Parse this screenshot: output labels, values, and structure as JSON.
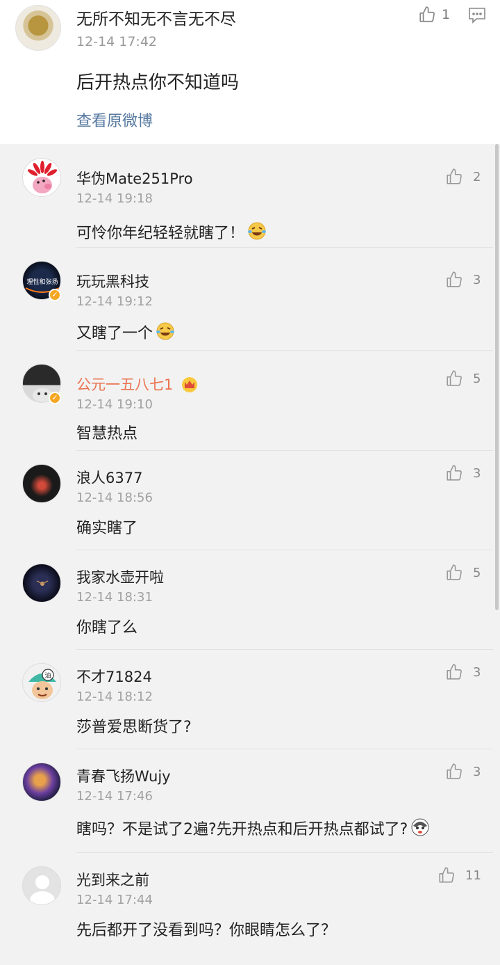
{
  "top": {
    "name": "无所不知无不言无不尽",
    "time": "12-14 17:42",
    "content": "后开热点你不知道吗",
    "link": "查看原微博",
    "likes": "1"
  },
  "comments": [
    {
      "name": "华伪Mate251Pro",
      "time": "12-14 19:18",
      "text": "可怜你年纪轻轻就瞎了！",
      "likes": "2"
    },
    {
      "name": "玩玩黑科技",
      "time": "12-14 19:12",
      "text": "又瞎了一个",
      "likes": "3"
    },
    {
      "name": "公元一五八七1",
      "time": "12-14 19:10",
      "text": "智慧热点",
      "likes": "5"
    },
    {
      "name": "浪人6377",
      "time": "12-14 18:56",
      "text": "确实瞎了",
      "likes": "3"
    },
    {
      "name": "我家水壶开啦",
      "time": "12-14 18:31",
      "text": "你瞎了么",
      "likes": "5"
    },
    {
      "name": "不才71824",
      "time": "12-14 18:12",
      "text": "莎普爱思断货了?",
      "likes": "3"
    },
    {
      "name": "青春飞扬Wujy",
      "time": "12-14 17:46",
      "text": "瞎吗？不是试了2遍?先开热点和后开热点都试了?",
      "likes": "3"
    },
    {
      "name": "光到来之前",
      "time": "12-14 17:44",
      "text": "先后都开了没看到吗？你眼睛怎么了？",
      "likes": "11"
    }
  ],
  "avatar_texts": {
    "c1": "理性和张扬",
    "c5": "油"
  },
  "icons": {
    "like": "thumbs-up-icon",
    "reply": "comment-icon",
    "verified": "verified-badge-icon",
    "vip": "crown-icon",
    "emoji_laugh": "laughing-crying-emoji",
    "emoji_husky": "husky-emoji"
  },
  "colors": {
    "link": "#56789f",
    "vip_name": "#eb7350",
    "verified": "#f5a623"
  }
}
